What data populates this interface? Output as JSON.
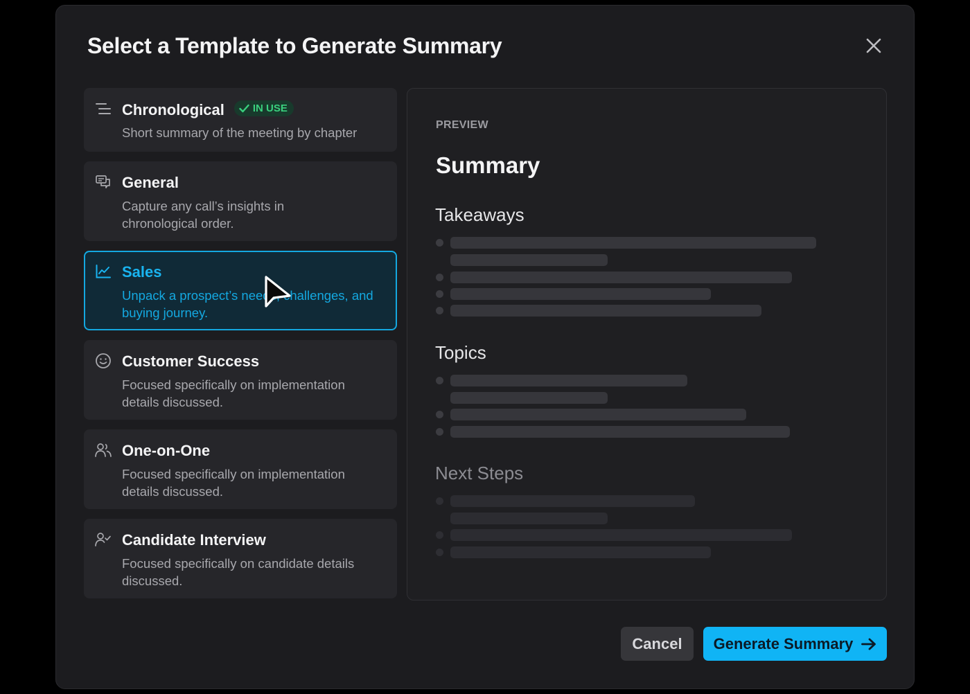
{
  "modal": {
    "title": "Select a Template to Generate Summary",
    "close_icon": "close-icon"
  },
  "templates": [
    {
      "title": "Chronological",
      "description": "Short summary of the meeting by chapter",
      "icon": "list-icon",
      "badge": "IN USE",
      "selected": false
    },
    {
      "title": "General",
      "description": "Capture any call’s insights in chronological order.",
      "icon": "chat-icon",
      "selected": false
    },
    {
      "title": "Sales",
      "description": "Unpack a prospect’s needs, challenges, and buying journey.",
      "icon": "line-chart-icon",
      "selected": true
    },
    {
      "title": "Customer Success",
      "description": "Focused specifically on implementation details discussed.",
      "icon": "smile-icon",
      "selected": false
    },
    {
      "title": "One-on-One",
      "description": "Focused specifically on implementation details discussed.",
      "icon": "users-icon",
      "selected": false
    },
    {
      "title": "Candidate Interview",
      "description": "Focused specifically on candidate details discussed.",
      "icon": "user-check-icon",
      "selected": false
    }
  ],
  "preview": {
    "label": "PREVIEW",
    "heading": "Summary",
    "sections": [
      {
        "title": "Takeaways"
      },
      {
        "title": "Topics"
      },
      {
        "title": "Next Steps"
      }
    ]
  },
  "actions": {
    "cancel": "Cancel",
    "generate": "Generate Summary"
  },
  "colors": {
    "accent": "#10b4f5",
    "badge_green": "#3ad07e",
    "background": "#1c1c1f"
  }
}
